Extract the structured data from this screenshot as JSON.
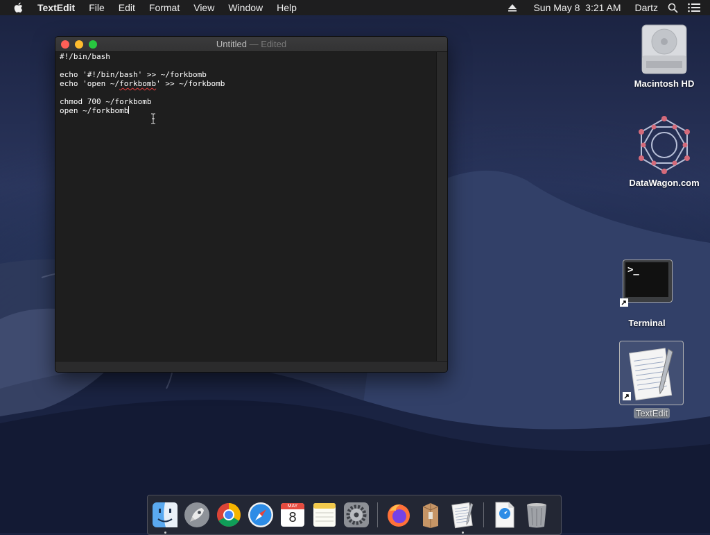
{
  "menubar": {
    "app_name": "TextEdit",
    "items": [
      "File",
      "Edit",
      "Format",
      "View",
      "Window",
      "Help"
    ],
    "clock": "Sun May 8  3:21 AM",
    "user": "Dartz"
  },
  "window": {
    "title": "Untitled",
    "title_suffix": " — Edited",
    "lines": [
      "#!/bin/bash",
      "",
      "echo '#!/bin/bash' >> ~/forkbomb",
      "echo 'open ~/forkbomb' >> ~/forkbomb",
      "",
      "chmod 700 ~/forkbomb",
      "open ~/forkbomb"
    ]
  },
  "desktop": {
    "icons": [
      {
        "label": "Macintosh HD",
        "icon": "hard-drive-icon"
      },
      {
        "label": "DataWagon.com",
        "icon": "network-volume-icon"
      },
      {
        "label": "Terminal",
        "icon": "terminal-icon"
      },
      {
        "label": "TextEdit",
        "icon": "textedit-icon"
      }
    ]
  },
  "dock": {
    "calendar_month": "MAY",
    "calendar_day": "8",
    "terminal_prompt": ">_"
  },
  "colors": {
    "menubar": "#1e1e1f",
    "editor_bg": "#1e1e1e",
    "close": "#fe5f57",
    "minimize": "#febc2e",
    "zoom": "#28c840"
  }
}
